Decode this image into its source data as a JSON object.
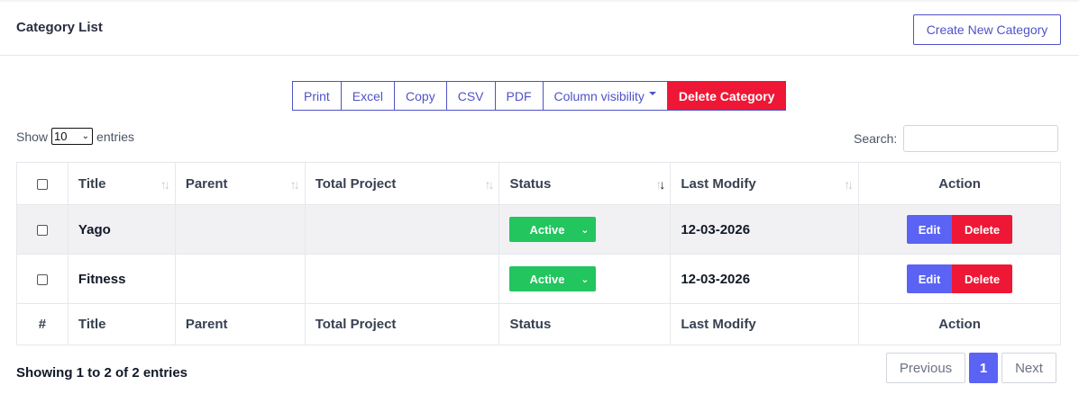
{
  "header": {
    "title": "Category List",
    "create_label": "Create New Category"
  },
  "toolbar": {
    "print": "Print",
    "excel": "Excel",
    "copy": "Copy",
    "csv": "CSV",
    "pdf": "PDF",
    "column_visibility": "Column visibility",
    "delete_category": "Delete Category"
  },
  "length": {
    "show": "Show",
    "value": "10",
    "entries": "entries"
  },
  "search": {
    "label": "Search:",
    "value": ""
  },
  "table": {
    "headers": [
      "Title",
      "Parent",
      "Total Project",
      "Status",
      "Last Modify",
      "Action"
    ],
    "footer": [
      "#",
      "Title",
      "Parent",
      "Total Project",
      "Status",
      "Last Modify",
      "Action"
    ],
    "rows": [
      {
        "title": "Yago",
        "parent": "",
        "total_project": "",
        "status": "Active",
        "last_modify": "12-03-2026",
        "edit": "Edit",
        "delete": "Delete"
      },
      {
        "title": "Fitness",
        "parent": "",
        "total_project": "",
        "status": "Active",
        "last_modify": "12-03-2026",
        "edit": "Edit",
        "delete": "Delete"
      }
    ]
  },
  "footer": {
    "info": "Showing 1 to 2 of 2 entries",
    "previous": "Previous",
    "current_page": "1",
    "next": "Next"
  },
  "colors": {
    "accent": "#4f52c9",
    "primary": "#5a63f4",
    "danger": "#ee1735",
    "success": "#22c55e"
  }
}
